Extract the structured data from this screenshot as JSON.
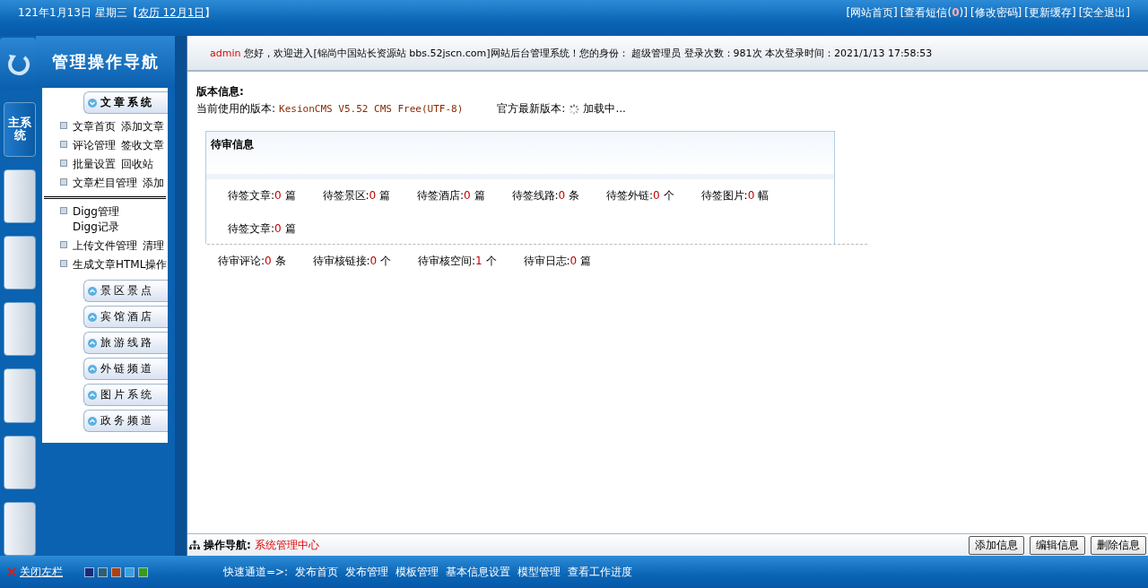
{
  "top_bar": {
    "date": "121年1月13日 星期三【",
    "lunar": "农历 12月1日",
    "date_end": "】",
    "links": [
      {
        "before": "[网站首页]"
      },
      {
        "before": "[查看短信(",
        "count": "0",
        "after": ")]"
      },
      {
        "before": "[修改密码]"
      },
      {
        "before": "[更新缓存]"
      },
      {
        "before": "[安全退出]"
      }
    ]
  },
  "sidebar": {
    "title": "管理操作导航",
    "tabs": [
      {
        "label": "主系统",
        "selected": true
      },
      {
        "selected": false
      },
      {
        "selected": false
      },
      {
        "selected": false
      },
      {
        "selected": false
      },
      {
        "selected": false
      },
      {
        "selected": false
      }
    ],
    "groups": [
      {
        "label": "文章系统",
        "expanded": true,
        "rows": [
          {
            "links": [
              "文章首页",
              "添加文章"
            ]
          },
          {
            "links": [
              "评论管理",
              "签收文章"
            ]
          },
          {
            "links": [
              "批量设置",
              "回收站"
            ]
          },
          {
            "links": [
              "文章栏目管理",
              "添加"
            ],
            "divider_after": true
          },
          {
            "links": [
              "Digg管理",
              "Digg记录"
            ]
          },
          {
            "links": [
              "上传文件管理",
              "清理"
            ]
          },
          {
            "links": [
              "生成文章HTML操作"
            ]
          }
        ]
      },
      {
        "label": "景区景点",
        "expanded": false
      },
      {
        "label": "宾馆酒店",
        "expanded": false
      },
      {
        "label": "旅游线路",
        "expanded": false
      },
      {
        "label": "外链频道",
        "expanded": false
      },
      {
        "label": "图片系统",
        "expanded": false
      },
      {
        "label": "政务频道",
        "expanded": false
      }
    ]
  },
  "welcome": {
    "user": "admin",
    "text": "您好，欢迎进入[锦尚中国站长资源站 bbs.52jscn.com]网站后台管理系统！您的身份： 超级管理员 登录次数：981次 本次登录时间：2021/1/13 17:58:53"
  },
  "version": {
    "title": "版本信息:",
    "current_label": "当前使用的版本:",
    "current_value": "KesionCMS V5.52 CMS Free(UTF-8)",
    "latest_label": "官方最新版本:",
    "latest_value": "加载中..."
  },
  "pending": {
    "title": "待审信息",
    "groups": [
      {
        "items": [
          {
            "label": "待签文章:",
            "value": "0",
            "unit": "篇"
          },
          {
            "label": "待签景区:",
            "value": "0",
            "unit": "篇"
          },
          {
            "label": "待签酒店:",
            "value": "0",
            "unit": "篇"
          },
          {
            "label": "待签线路:",
            "value": "0",
            "unit": "条"
          },
          {
            "label": "待签外链:",
            "value": "0",
            "unit": "个"
          },
          {
            "label": "待签图片:",
            "value": "0",
            "unit": "幅"
          },
          {
            "label": "待签文章:",
            "value": "0",
            "unit": "篇"
          }
        ]
      },
      {
        "items": [
          {
            "label": "待审评论:",
            "value": "0",
            "unit": "条"
          },
          {
            "label": "待审核链接:",
            "value": "0",
            "unit": "个"
          },
          {
            "label": "待审核空间:",
            "value": "1",
            "unit": "个"
          },
          {
            "label": "待审日志:",
            "value": "0",
            "unit": "篇"
          }
        ]
      }
    ]
  },
  "nav_bar": {
    "label": "操作导航:",
    "location": "系统管理中心",
    "buttons": [
      "添加信息",
      "编辑信息",
      "删除信息"
    ]
  },
  "footer": {
    "close_label": "关闭左栏",
    "themes": [
      {
        "color": "#1a2a7a"
      },
      {
        "color": "#2f5f74"
      },
      {
        "color": "#b0400e"
      },
      {
        "color": "#3aa0e0"
      },
      {
        "color": "#3a9a1a"
      }
    ],
    "quick_label": "快速通道=>:",
    "quick_links": [
      "发布首页",
      "发布管理",
      "模板管理",
      "基本信息设置",
      "模型管理",
      "查看工作进度"
    ]
  }
}
